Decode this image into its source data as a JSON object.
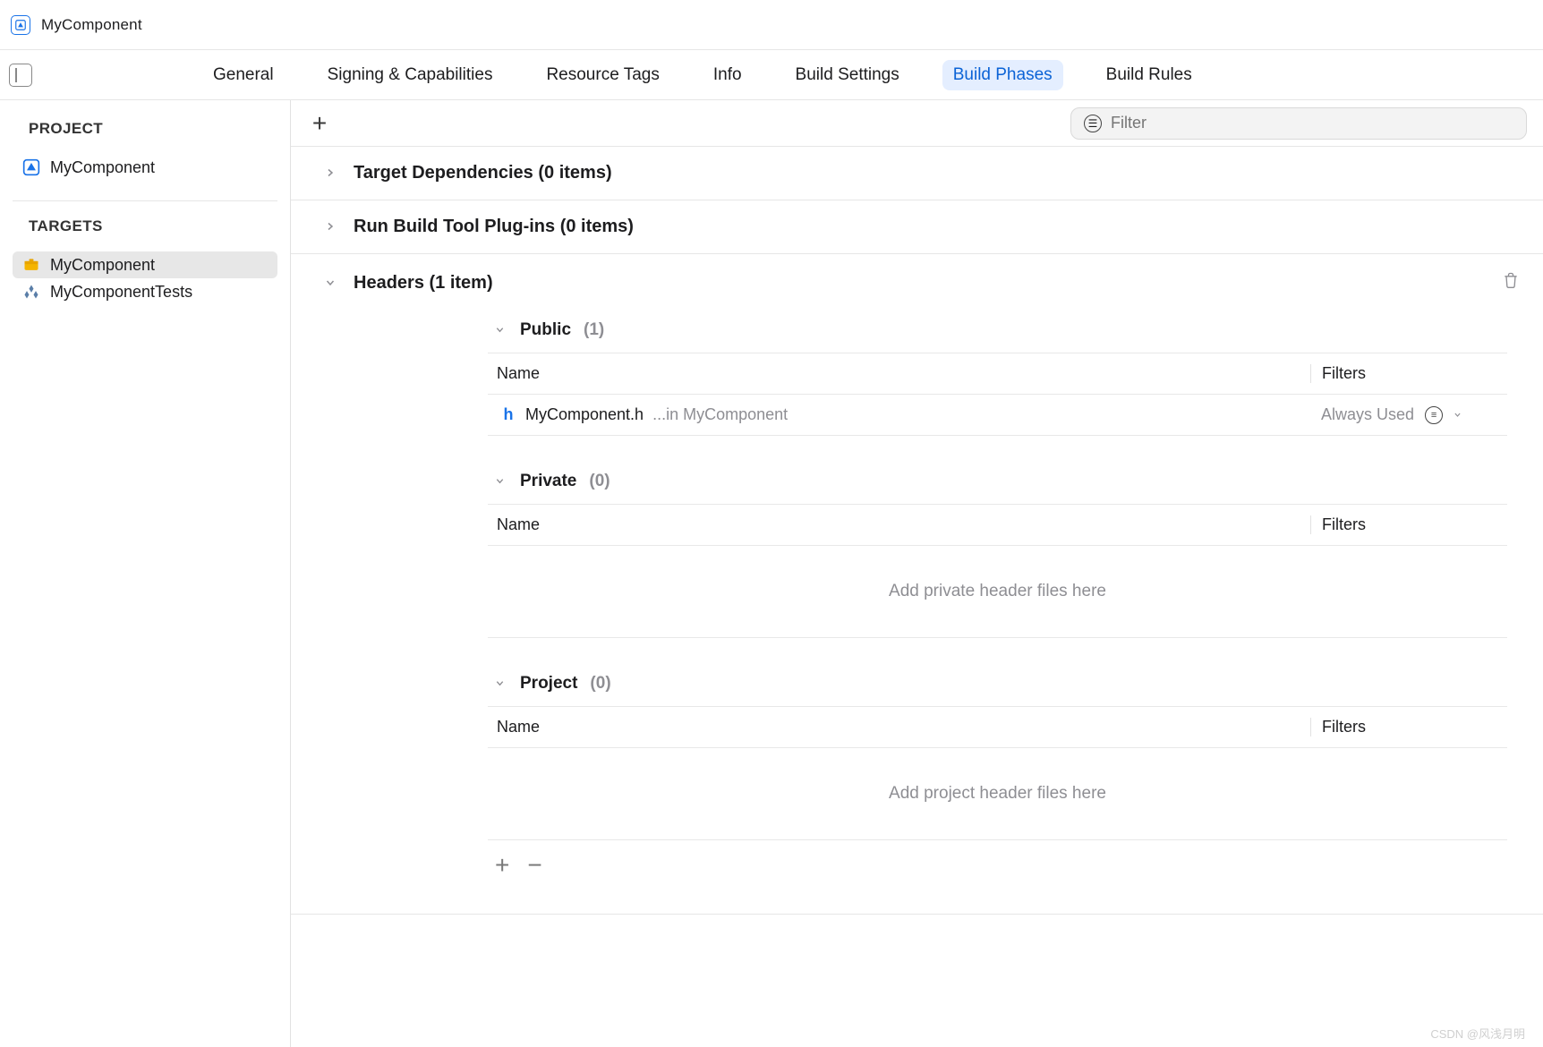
{
  "title": "MyComponent",
  "tabs": {
    "items": [
      {
        "label": "General"
      },
      {
        "label": "Signing & Capabilities"
      },
      {
        "label": "Resource Tags"
      },
      {
        "label": "Info"
      },
      {
        "label": "Build Settings"
      },
      {
        "label": "Build Phases"
      },
      {
        "label": "Build Rules"
      }
    ],
    "active_index": 5
  },
  "sidebar": {
    "project_header": "PROJECT",
    "project": {
      "name": "MyComponent"
    },
    "targets_header": "TARGETS",
    "targets": [
      {
        "name": "MyComponent",
        "selected": true,
        "icon": "framework"
      },
      {
        "name": "MyComponentTests",
        "selected": false,
        "icon": "tests"
      }
    ]
  },
  "filter": {
    "placeholder": "Filter"
  },
  "phases": {
    "target_dependencies": {
      "title": "Target Dependencies",
      "count_text": "(0 items)"
    },
    "run_build_tool": {
      "title": "Run Build Tool Plug-ins",
      "count_text": "(0 items)"
    },
    "headers": {
      "title": "Headers",
      "count_text": "(1 item)",
      "columns": {
        "name": "Name",
        "filters": "Filters"
      },
      "groups": {
        "public": {
          "label": "Public",
          "count": "(1)",
          "files": [
            {
              "name": "MyComponent.h",
              "path_hint": "...in MyComponent",
              "filter": "Always Used"
            }
          ]
        },
        "private": {
          "label": "Private",
          "count": "(0)",
          "empty_message": "Add private header files here"
        },
        "project": {
          "label": "Project",
          "count": "(0)",
          "empty_message": "Add project header files here"
        }
      }
    }
  },
  "watermark": "CSDN @风浅月明"
}
